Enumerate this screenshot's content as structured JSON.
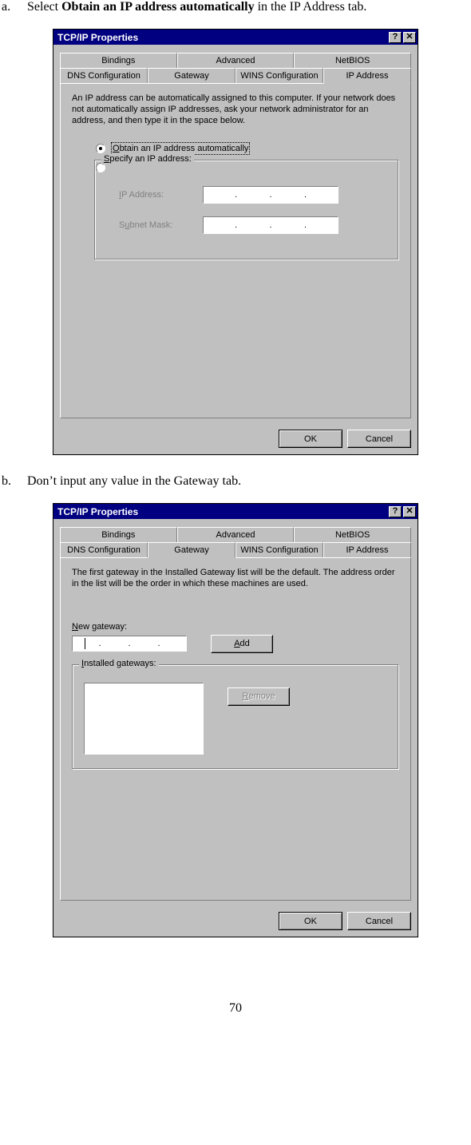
{
  "steps": {
    "a": {
      "letter": "a.",
      "pre": "Select ",
      "bold": "Obtain an IP address automatically",
      "post": " in the IP Address tab."
    },
    "b": {
      "letter": "b.",
      "text": "Don’t input any value in the Gateway tab."
    }
  },
  "dialog1": {
    "title": "TCP/IP Properties",
    "help": "?",
    "close": "✕",
    "tabs_back": [
      "Bindings",
      "Advanced",
      "NetBIOS"
    ],
    "tabs_front": [
      "DNS Configuration",
      "Gateway",
      "WINS Configuration",
      "IP Address"
    ],
    "active_tab": "IP Address",
    "desc": "An IP address can be automatically assigned to this computer. If your network does not automatically assign IP addresses, ask your network administrator for an address, and then type it in the space below.",
    "radio_auto": "Obtain an IP address automatically",
    "radio_specify": "Specify an IP address:",
    "ip_label": "IP Address:",
    "mask_label": "Subnet Mask:",
    "ok": "OK",
    "cancel": "Cancel"
  },
  "dialog2": {
    "title": "TCP/IP Properties",
    "help": "?",
    "close": "✕",
    "tabs_back": [
      "Bindings",
      "Advanced",
      "NetBIOS"
    ],
    "tabs_front": [
      "DNS Configuration",
      "Gateway",
      "WINS Configuration",
      "IP Address"
    ],
    "active_tab": "Gateway",
    "desc": "The first gateway in the Installed Gateway list will be the default. The address order in the list will be the order in which these machines are used.",
    "new_label": "New gateway:",
    "add": "Add",
    "installed_label": "Installed gateways:",
    "remove": "Remove",
    "ok": "OK",
    "cancel": "Cancel"
  },
  "page_number": "70"
}
